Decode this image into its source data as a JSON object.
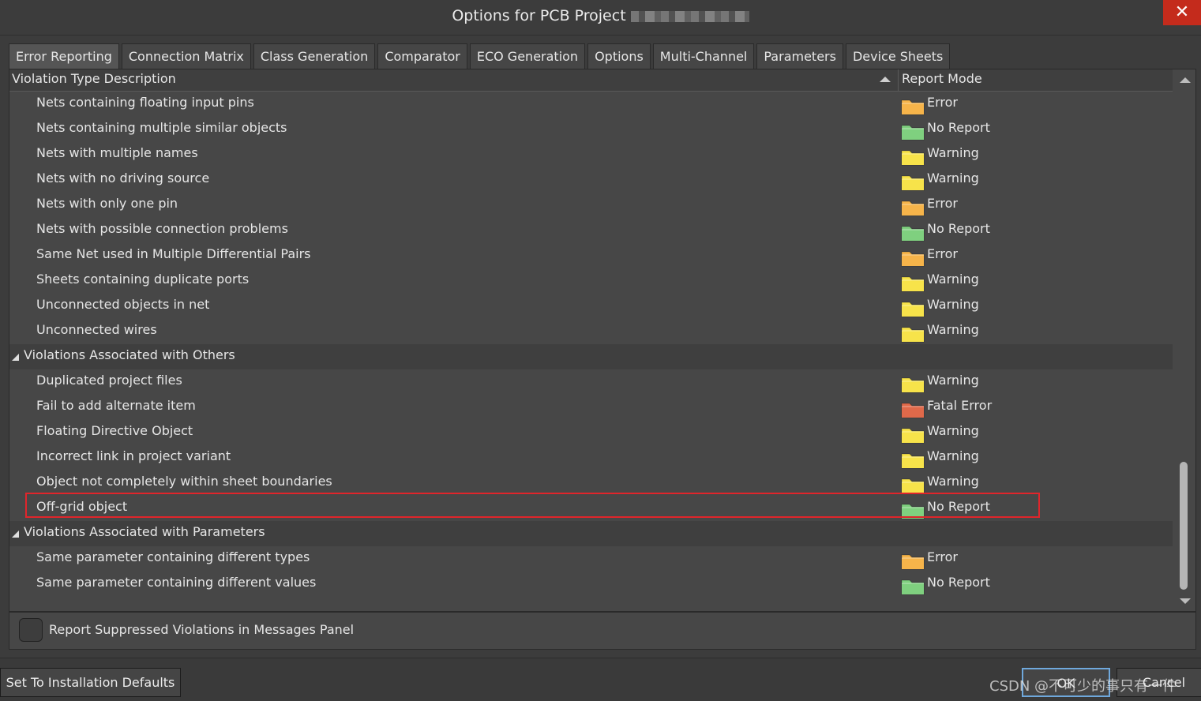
{
  "window": {
    "title": "Options for PCB Project",
    "close_glyph": "✕"
  },
  "tabs": [
    {
      "label": "Error Reporting",
      "active": true
    },
    {
      "label": "Connection Matrix"
    },
    {
      "label": "Class Generation"
    },
    {
      "label": "Comparator"
    },
    {
      "label": "ECO Generation"
    },
    {
      "label": "Options"
    },
    {
      "label": "Multi-Channel"
    },
    {
      "label": "Parameters"
    },
    {
      "label": "Device Sheets"
    }
  ],
  "table": {
    "col_description": "Violation Type Description",
    "col_mode": "Report Mode",
    "sort_icon": "sort-ascending-icon",
    "rows": [
      {
        "desc": "Nets containing floating input pins",
        "mode": "Error",
        "icon": "folder-orange-icon"
      },
      {
        "desc": "Nets containing multiple similar objects",
        "mode": "No Report",
        "icon": "folder-green-icon"
      },
      {
        "desc": "Nets with multiple names",
        "mode": "Warning",
        "icon": "folder-yellow-icon"
      },
      {
        "desc": "Nets with no driving source",
        "mode": "Warning",
        "icon": "folder-yellow-icon"
      },
      {
        "desc": "Nets with only one pin",
        "mode": "Error",
        "icon": "folder-orange-icon"
      },
      {
        "desc": "Nets with possible connection problems",
        "mode": "No Report",
        "icon": "folder-green-icon"
      },
      {
        "desc": "Same Net used in Multiple Differential Pairs",
        "mode": "Error",
        "icon": "folder-orange-icon"
      },
      {
        "desc": "Sheets containing duplicate ports",
        "mode": "Warning",
        "icon": "folder-yellow-icon"
      },
      {
        "desc": "Unconnected objects in net",
        "mode": "Warning",
        "icon": "folder-yellow-icon"
      },
      {
        "desc": "Unconnected wires",
        "mode": "Warning",
        "icon": "folder-yellow-icon"
      },
      {
        "group": true,
        "desc": "Violations Associated with Others"
      },
      {
        "desc": "Duplicated project files",
        "mode": "Warning",
        "icon": "folder-yellow-icon"
      },
      {
        "desc": "Fail to add alternate item",
        "mode": "Fatal Error",
        "icon": "folder-red-icon"
      },
      {
        "desc": "Floating Directive Object",
        "mode": "Warning",
        "icon": "folder-yellow-icon"
      },
      {
        "desc": "Incorrect link in project variant",
        "mode": "Warning",
        "icon": "folder-yellow-icon"
      },
      {
        "desc": "Object not completely within sheet boundaries",
        "mode": "Warning",
        "icon": "folder-yellow-icon"
      },
      {
        "desc": "Off-grid object",
        "mode": "No Report",
        "icon": "folder-green-icon",
        "highlighted": true
      },
      {
        "group": true,
        "desc": "Violations Associated with Parameters"
      },
      {
        "desc": "Same parameter containing different types",
        "mode": "Error",
        "icon": "folder-orange-icon"
      },
      {
        "desc": "Same parameter containing different values",
        "mode": "No Report",
        "icon": "folder-green-icon"
      }
    ]
  },
  "mode_colors": {
    "Error": "#f6b44a",
    "Warning": "#f7e34a",
    "No Report": "#7fd07f",
    "Fatal Error": "#e0694a"
  },
  "options": {
    "report_suppressed_label": "Report Suppressed Violations in Messages Panel",
    "report_suppressed_checked": false
  },
  "buttons": {
    "defaults": "Set To Installation Defaults",
    "ok": "OK",
    "cancel": "Cancel"
  },
  "watermark": "CSDN @不可少的事只有一件"
}
